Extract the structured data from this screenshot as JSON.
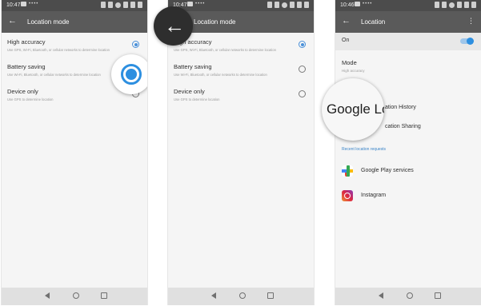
{
  "colors": {
    "accent": "#2d8fe0",
    "appbar": "#5a5a5a",
    "statusbar": "#4c4c4c",
    "link": "#3a84c8"
  },
  "panel1": {
    "status_time": "10:47",
    "title": "Location mode",
    "options": [
      {
        "label": "High accuracy",
        "sub": "Use GPS, Wi-Fi, Bluetooth, or cellular networks to determine location",
        "selected": true
      },
      {
        "label": "Battery saving",
        "sub": "Use Wi-Fi, Bluetooth, or cellular networks to determine location",
        "selected": false
      },
      {
        "label": "Device only",
        "sub": "Use GPS to determine location",
        "selected": false
      }
    ]
  },
  "panel2": {
    "status_time": "10:47",
    "title": "Location mode",
    "options": [
      {
        "label": "High accuracy",
        "sub": "Use GPS, Wi-Fi, Bluetooth, or cellular networks to determine location",
        "selected": true
      },
      {
        "label": "Battery saving",
        "sub": "Use Wi-Fi, Bluetooth, or cellular networks to determine location",
        "selected": false
      },
      {
        "label": "Device only",
        "sub": "Use GPS to determine location",
        "selected": false
      }
    ]
  },
  "panel3": {
    "status_time": "10:46",
    "title": "Location",
    "on_label": "On",
    "mode_label": "Mode",
    "mode_sub": "High accuracy",
    "history_label": "Google Location History",
    "sharing_label": "Google Location Sharing",
    "zoom_text": "Google Loc",
    "history_visible": "ation History",
    "sharing_visible": "cation Sharing",
    "recent_label": "Recent location requests",
    "apps": [
      {
        "name": "Google Play services",
        "icon": "google-play-services-icon"
      },
      {
        "name": "Instagram",
        "icon": "instagram-icon"
      }
    ]
  }
}
